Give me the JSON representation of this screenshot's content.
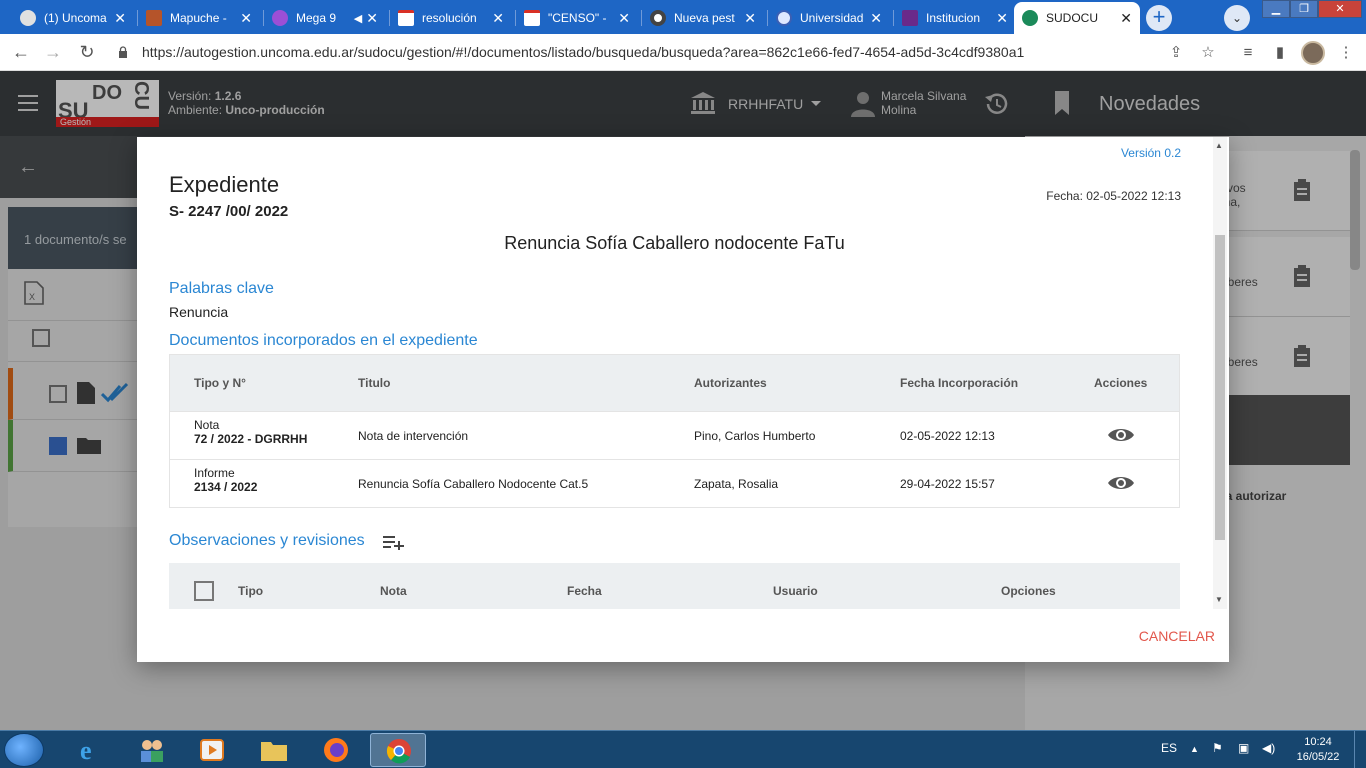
{
  "browser": {
    "tabs": [
      {
        "title": "(1) Uncoma",
        "icon_color": "#e0e0e0"
      },
      {
        "title": "Mapuche -",
        "icon_color": "#b5542a"
      },
      {
        "title": "Mega 9",
        "icon_color": "#9b4fd6"
      },
      {
        "title": "resolución",
        "icon_color": "#d93025"
      },
      {
        "title": "\"CENSO\" -",
        "icon_color": "#d93025"
      },
      {
        "title": "Nueva pest",
        "icon_color": "#444444"
      },
      {
        "title": "Universidad",
        "icon_color": "#3b5fb3"
      },
      {
        "title": "Institucion",
        "icon_color": "#6a2a8a"
      },
      {
        "title": "SUDOCU",
        "icon_color": "#1b8a5a"
      }
    ],
    "new_tab_label": "+",
    "url": "https://autogestion.uncoma.edu.ar/sudocu/gestion/#!/documentos/listado/busqueda/busqueda?area=862c1e66-fed7-4654-ad5d-3c4cdf9380a1"
  },
  "app": {
    "logo": {
      "su": "SU",
      "do": "DO",
      "cu": "CU",
      "sub": "Gestión"
    },
    "version_label": "Versión:",
    "version_value": "1.2.6",
    "env_label": "Ambiente:",
    "env_value": "Unco-producción",
    "org": "RRHHFATU",
    "user_line1": "Marcela Silvana",
    "user_line2": "Molina"
  },
  "side_panel": {
    "title": "Novedades",
    "cards": [
      {
        "line1": "tivos",
        "line2": "ina,",
        "line3": "3"
      },
      {
        "line1": "aberes",
        "line2": "",
        "line3": ""
      },
      {
        "line1": "aberes",
        "line2": "",
        "line3": ""
      }
    ],
    "auth_text": "ra autorizar"
  },
  "background": {
    "results_text": "1 documento/s se"
  },
  "modal": {
    "version": "Versión 0.2",
    "title": "Expediente",
    "expediente_number": "S- 2247 /00/ 2022",
    "fecha": "Fecha: 02-05-2022 12:13",
    "subject": "Renuncia Sofía Caballero nodocente FaTu",
    "keywords_title": "Palabras clave",
    "keywords_value": "Renuncia",
    "docs_title": "Documentos incorporados en el expediente",
    "doc_columns": [
      "Tipo y N°",
      "Titulo",
      "Autorizantes",
      "Fecha Incorporación",
      "Acciones"
    ],
    "doc_rows": [
      {
        "tipo": "Nota",
        "numero": "72 / 2022 - DGRRHH",
        "titulo": "Nota de intervención",
        "autorizantes": "Pino, Carlos Humberto",
        "fecha": "02-05-2022 12:13"
      },
      {
        "tipo": "Informe",
        "numero": "2134 / 2022",
        "titulo": "Renuncia Sofía Caballero Nodocente Cat.5",
        "autorizantes": "Zapata, Rosalia",
        "fecha": "29-04-2022 15:57"
      }
    ],
    "obs_title": "Observaciones y revisiones",
    "obs_columns": [
      "Tipo",
      "Nota",
      "Fecha",
      "Usuario",
      "Opciones"
    ],
    "cancel_label": "CANCELAR"
  },
  "taskbar": {
    "lang": "ES",
    "time": "10:24",
    "date": "16/05/22"
  }
}
